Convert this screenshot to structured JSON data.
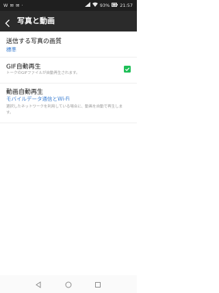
{
  "status_bar": {
    "left_icons": "W ✉ ✉ ·",
    "battery": "93%",
    "time": "21:57"
  },
  "toolbar": {
    "back_icon": "chevron-left-icon",
    "title": "写真と動画"
  },
  "settings": {
    "photo_quality": {
      "title": "送信する写真の画質",
      "value": "標準"
    },
    "gif_autoplay": {
      "title": "GIF自動再生",
      "description": "トークのGIFファイルが自動再生されます。",
      "checked": true
    },
    "video_autoplay": {
      "title": "動画自動再生",
      "value": "モバイルデータ通信とWi-Fi",
      "description": "選択したネットワークを利用している場合に、動画を自動で再生します。"
    }
  },
  "colors": {
    "accent_blue": "#3d7fd2",
    "check_green": "#1fbf58",
    "toolbar_bg": "#2b2b2b"
  }
}
